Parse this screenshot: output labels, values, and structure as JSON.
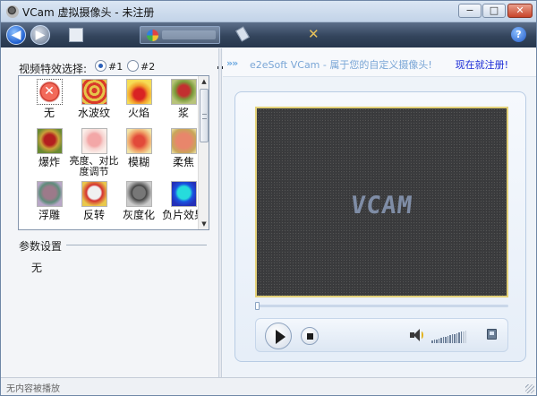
{
  "window": {
    "title": "VCam 虚拟摄像头 - 未注册"
  },
  "window_controls": {
    "minimize": "−",
    "maximize": "□",
    "close": "✕"
  },
  "toolbar": {
    "back_arrow": "◀",
    "forward_arrow": "▶",
    "tools_glyph": "✕",
    "help": "?"
  },
  "effects": {
    "label": "视频特效选择:",
    "options": [
      "#1",
      "#2"
    ],
    "selected_option": "#1",
    "items": [
      {
        "name": "无",
        "icon": "none-icon",
        "thumb": "thumb-none"
      },
      {
        "name": "水波纹",
        "icon": "ripple-icon",
        "thumb": "rose-ripple"
      },
      {
        "name": "火焰",
        "icon": "flame-icon",
        "thumb": "rose-fire"
      },
      {
        "name": "浆",
        "icon": "ink-icon",
        "thumb": "rose-ink"
      },
      {
        "name": "爆炸",
        "icon": "explode-icon",
        "thumb": "rose-burst"
      },
      {
        "name": "亮度、对比度调节",
        "icon": "brightness-icon",
        "thumb": "rose-pale"
      },
      {
        "name": "模糊",
        "icon": "blur-icon",
        "thumb": "rose-soft"
      },
      {
        "name": "柔焦",
        "icon": "soft-focus-icon",
        "thumb": "rose-blur"
      },
      {
        "name": "浮雕",
        "icon": "emboss-icon",
        "thumb": "rose-emboss"
      },
      {
        "name": "反转",
        "icon": "invert-icon",
        "thumb": "rose-inv"
      },
      {
        "name": "灰度化",
        "icon": "grayscale-icon",
        "thumb": "rose-gray"
      },
      {
        "name": "负片效果",
        "icon": "negative-icon",
        "thumb": "rose-neg"
      }
    ],
    "selected_index": 0
  },
  "params": {
    "title": "参数设置",
    "value": "无"
  },
  "banner": {
    "arrows": "»»",
    "text": "e2eSoft VCam - 属于您的自定义摄像头!",
    "link": "现在就注册!"
  },
  "video": {
    "logo": "VCAM",
    "seek_position": 0
  },
  "player": {
    "volume_level": 0.85
  },
  "status": {
    "text": "无内容被播放"
  },
  "colors": {
    "accent": "#2a5fb8",
    "link": "#1a2bd6",
    "banner_text": "#7aa6d6",
    "video_border": "#e3d179"
  }
}
